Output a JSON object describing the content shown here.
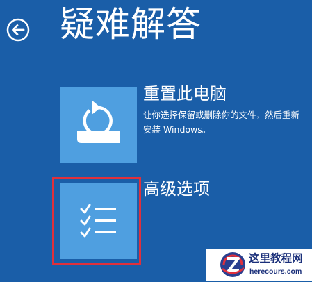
{
  "header": {
    "back_icon": "arrow-left-circle-icon",
    "title": "疑难解答"
  },
  "options": [
    {
      "id": "reset",
      "icon": "reset-pc-icon",
      "title": "重置此电脑",
      "description": "让你选择保留或删除你的文件，然后重新安装 Windows。"
    },
    {
      "id": "advanced",
      "icon": "checklist-icon",
      "title": "高级选项",
      "selected": true
    }
  ],
  "watermark": {
    "logo_icon": "z-logo-icon",
    "name": "这里教程网",
    "url": "herecours.com"
  },
  "colors": {
    "background": "#1a5ea8",
    "tile": "#4f9fe0",
    "text": "#ffffff",
    "selection": "#e0303c"
  }
}
